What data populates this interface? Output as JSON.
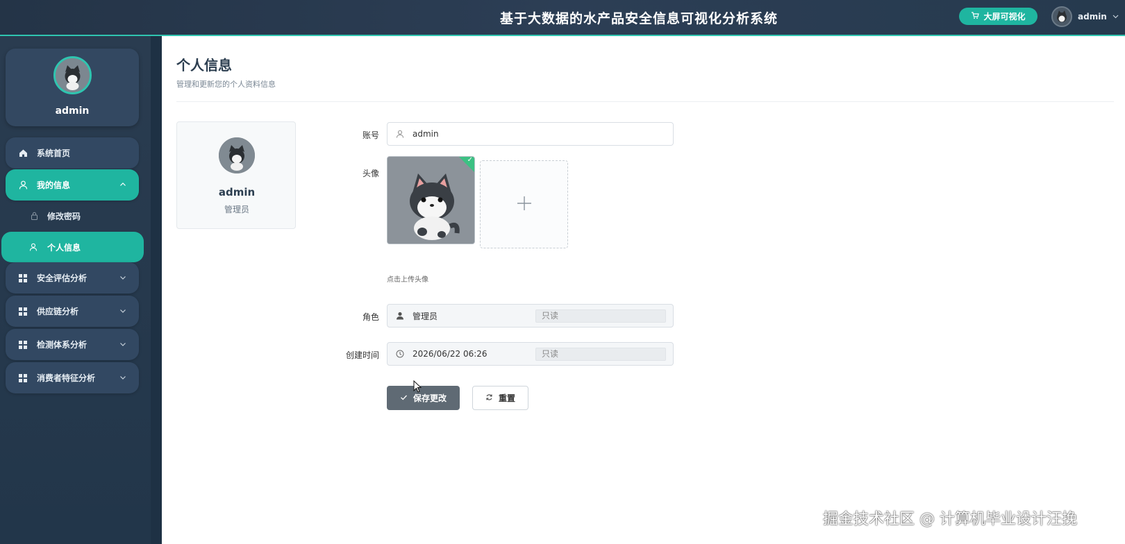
{
  "header": {
    "title": "基于大数据的水产品安全信息可视化分析系统",
    "bigscreen_label": "大屏可视化",
    "username": "admin"
  },
  "sidebar": {
    "profile_name": "admin",
    "items": [
      {
        "label": "系统首页",
        "icon": "home-icon"
      },
      {
        "label": "我的信息",
        "icon": "user-icon",
        "active": true,
        "expanded": true
      },
      {
        "label": "修改密码",
        "icon": "lock-icon",
        "sub": true
      },
      {
        "label": "个人信息",
        "icon": "user-icon",
        "sub": true,
        "active": true
      },
      {
        "label": "安全评估分析",
        "icon": "grid-icon"
      },
      {
        "label": "供应链分析",
        "icon": "grid-icon"
      },
      {
        "label": "检测体系分析",
        "icon": "grid-icon"
      },
      {
        "label": "消费者特征分析",
        "icon": "grid-icon"
      }
    ]
  },
  "main": {
    "title": "个人信息",
    "subtitle": "管理和更新您的个人资料信息",
    "card": {
      "name": "admin",
      "role": "管理员"
    },
    "form": {
      "account_label": "账号",
      "account_value": "admin",
      "avatar_label": "头像",
      "upload_tip": "点击上传头像",
      "role_label": "角色",
      "role_value": "管理员",
      "role_readonly": "只读",
      "created_label": "创建时间",
      "created_value": "2026/06/22 06:26",
      "created_readonly": "只读"
    },
    "buttons": {
      "save": "保存更改",
      "reset": "重置"
    }
  },
  "watermark": "掘金技术社区 @ 计算机毕业设计汪挽",
  "colors": {
    "accent": "#1fb5a0",
    "sidebar": "#2a3c50",
    "save_button": "#5f6a74"
  }
}
